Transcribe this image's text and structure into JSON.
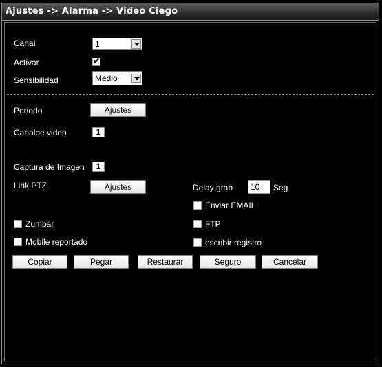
{
  "window": {
    "title": "Ajustes -> Alarma -> Video Ciego"
  },
  "form": {
    "canal": {
      "label": "Canal",
      "value": "1"
    },
    "activar": {
      "label": "Activar",
      "checked": true
    },
    "sensibilidad": {
      "label": "Sensibilidad",
      "value": "Medio"
    },
    "periodo": {
      "label": "Periodo",
      "button": "Ajustes"
    },
    "canal_video": {
      "label": "Canalde video",
      "value": "1"
    },
    "captura": {
      "label": "Captura de Imagen",
      "value": "1"
    },
    "link_ptz": {
      "label": "Link PTZ",
      "button": "Ajustes"
    },
    "delay": {
      "label": "Delay grab",
      "value": "10",
      "unit": "Seg"
    },
    "enviar_email": {
      "label": "Enviar EMAIL",
      "checked": false
    },
    "zumbar": {
      "label": "Zumbar",
      "checked": false
    },
    "ftp": {
      "label": "FTP",
      "checked": false
    },
    "mobile": {
      "label": "Mobile reportado",
      "checked": false
    },
    "registro": {
      "label": "escribir registro",
      "checked": false
    }
  },
  "actions": {
    "copiar": "Copiar",
    "pegar": "Pegar",
    "restaurar": "Restaurar",
    "seguro": "Seguro",
    "cancelar": "Cancelar"
  },
  "check_glyph": "✔"
}
